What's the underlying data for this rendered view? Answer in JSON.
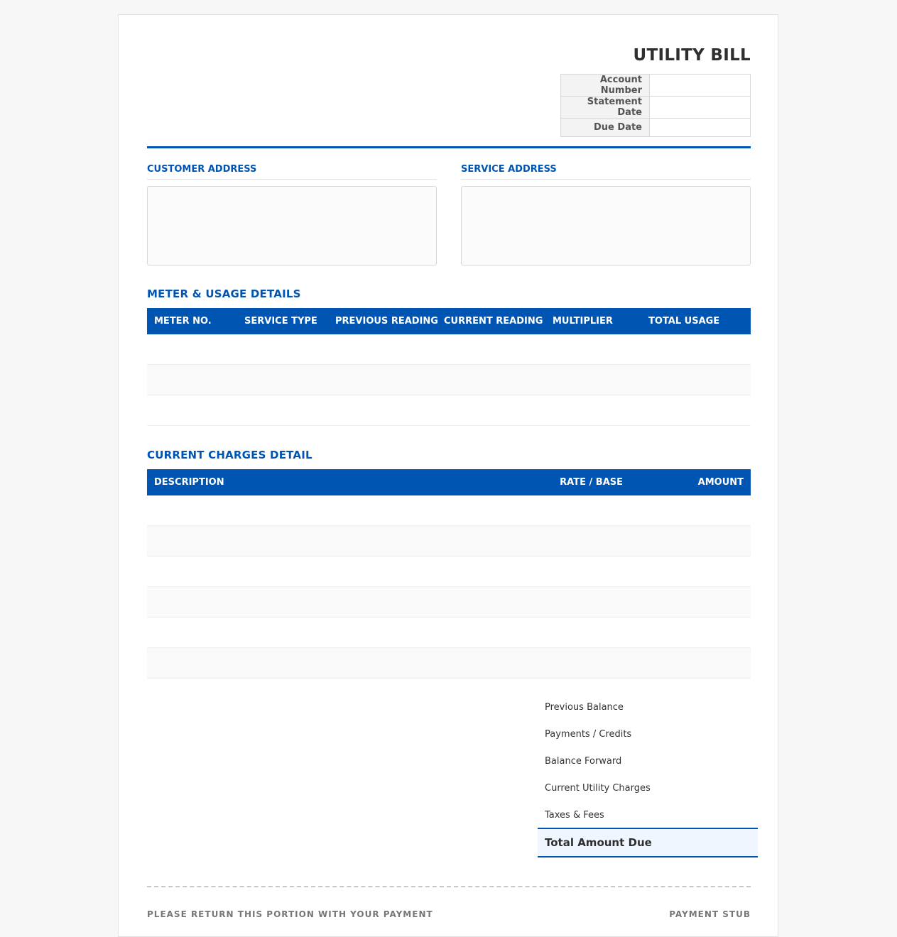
{
  "header": {
    "title": "UTILITY BILL",
    "meta": [
      {
        "label": "Account Number",
        "value": ""
      },
      {
        "label": "Statement Date",
        "value": ""
      },
      {
        "label": "Due Date",
        "value": ""
      }
    ]
  },
  "addresses": {
    "customer_title": "CUSTOMER ADDRESS",
    "customer_value": "",
    "service_title": "SERVICE ADDRESS",
    "service_value": ""
  },
  "meter": {
    "title": "METER & USAGE DETAILS",
    "columns": [
      "METER NO.",
      "SERVICE TYPE",
      "PREVIOUS READING",
      "CURRENT READING",
      "MULTIPLIER",
      "TOTAL USAGE"
    ]
  },
  "charges": {
    "title": "CURRENT CHARGES DETAIL",
    "columns": [
      "DESCRIPTION",
      "RATE / BASE",
      "AMOUNT"
    ]
  },
  "summary": {
    "items": [
      "Previous Balance",
      "Payments / Credits",
      "Balance Forward",
      "Current Utility Charges",
      "Taxes & Fees"
    ],
    "total_label": "Total Amount Due"
  },
  "stub": {
    "left": "PLEASE RETURN THIS PORTION WITH YOUR PAYMENT",
    "right": "PAYMENT STUB"
  },
  "colors": {
    "accent": "#0055b3",
    "total_bg": "#eff6ff"
  }
}
